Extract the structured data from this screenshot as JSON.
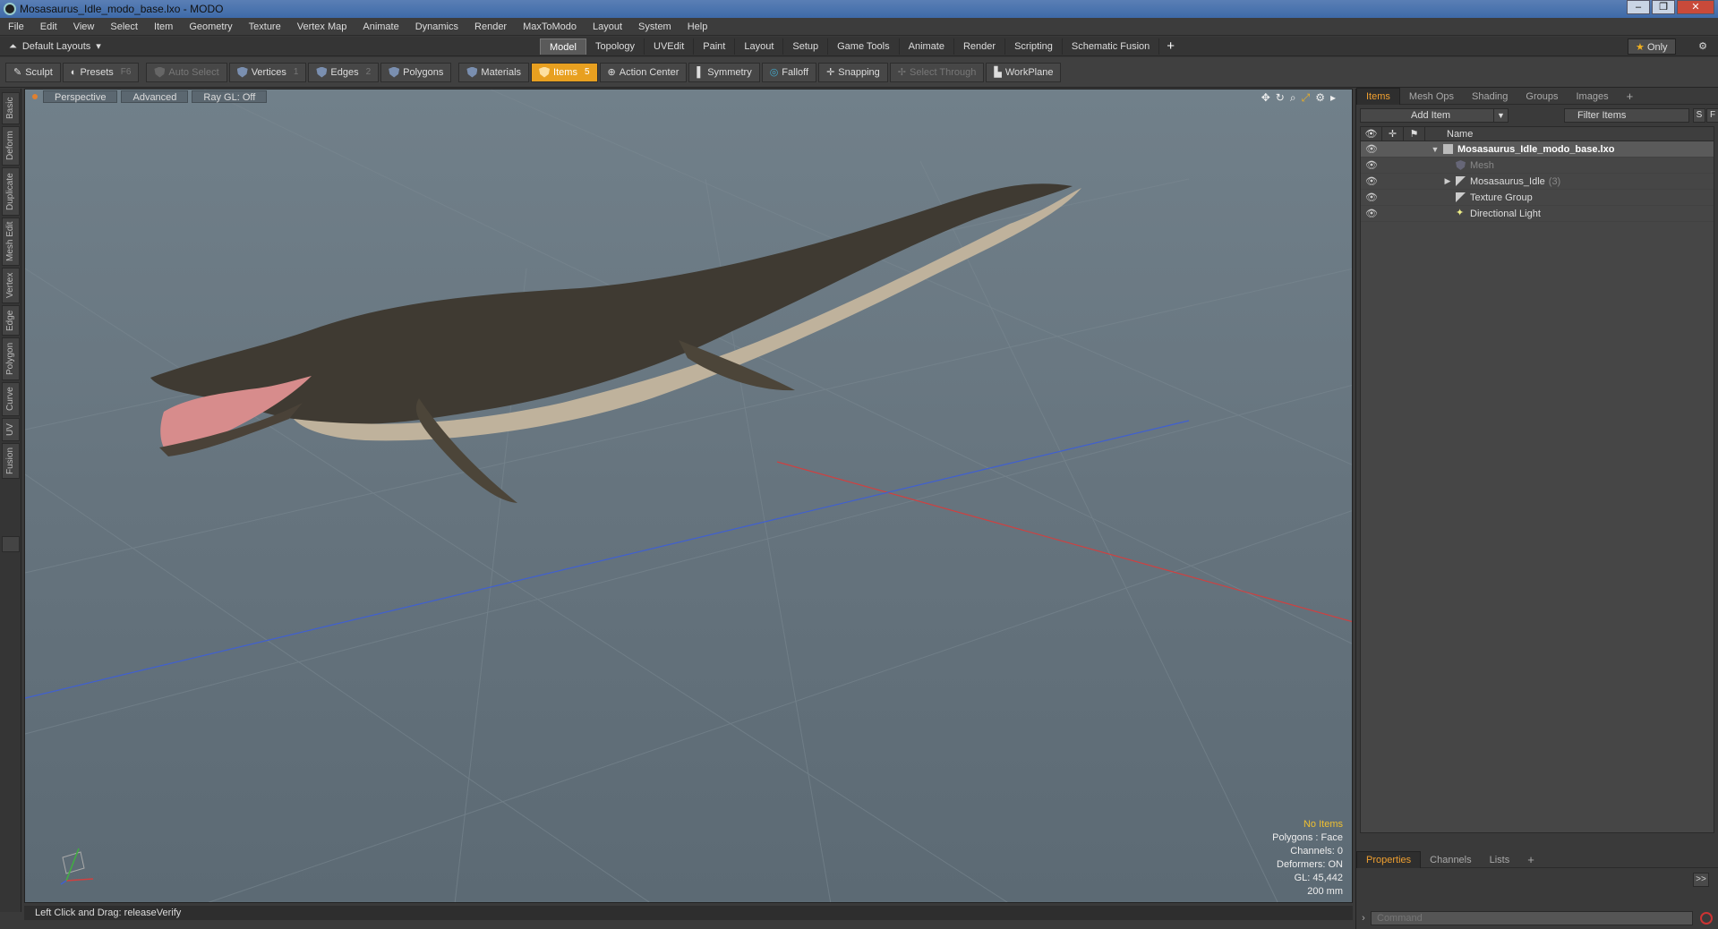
{
  "window": {
    "title": "Mosasaurus_Idle_modo_base.lxo - MODO",
    "buttons": [
      "–",
      "❐",
      "✕"
    ]
  },
  "menubar": [
    "File",
    "Edit",
    "View",
    "Select",
    "Item",
    "Geometry",
    "Texture",
    "Vertex Map",
    "Animate",
    "Dynamics",
    "Render",
    "MaxToModo",
    "Layout",
    "System",
    "Help"
  ],
  "layout_bar": {
    "layout_dropdown": "Default Layouts",
    "tabs": [
      "Model",
      "Topology",
      "UVEdit",
      "Paint",
      "Layout",
      "Setup",
      "Game Tools",
      "Animate",
      "Render",
      "Scripting",
      "Schematic Fusion"
    ],
    "active_tab": "Model",
    "add_label": "+",
    "only_label": "Only"
  },
  "toolbar": {
    "sculpt": "Sculpt",
    "presets": "Presets",
    "presets_key": "F6",
    "auto_select": "Auto Select",
    "vertices": "Vertices",
    "vertices_key": "1",
    "edges": "Edges",
    "edges_key": "2",
    "polygons": "Polygons",
    "materials": "Materials",
    "items": "Items",
    "items_key": "5",
    "action_center": "Action Center",
    "symmetry": "Symmetry",
    "falloff": "Falloff",
    "snapping": "Snapping",
    "select_through": "Select Through",
    "workplane": "WorkPlane"
  },
  "left_tabs": [
    "Basic",
    "Deform",
    "Duplicate",
    "Mesh Edit",
    "Vertex",
    "Edge",
    "Polygon",
    "Curve",
    "UV",
    "Fusion"
  ],
  "viewport": {
    "view_mode": "Perspective",
    "shading": "Advanced",
    "raygl": "Ray GL: Off",
    "info": {
      "selection": "No Items",
      "polygons": "Polygons : Face",
      "channels": "Channels: 0",
      "deformers": "Deformers: ON",
      "gl": "GL: 45,442",
      "scale": "200 mm"
    }
  },
  "statusbar": {
    "text": "Left Click and Drag:  releaseVerify"
  },
  "right_panel": {
    "tabs": [
      "Items",
      "Mesh Ops",
      "Shading",
      "Groups",
      "Images"
    ],
    "active_tab": "Items",
    "add_item": "Add Item",
    "filter_placeholder": "Filter Items",
    "s_btn": "S",
    "f_btn": "F",
    "column_name": "Name",
    "items": [
      {
        "label": "Mosasaurus_Idle_modo_base.lxo",
        "type": "scene"
      },
      {
        "label": "Mesh",
        "type": "mesh"
      },
      {
        "label": "Mosasaurus_Idle",
        "count": "(3)",
        "type": "group"
      },
      {
        "label": "Texture Group",
        "type": "group"
      },
      {
        "label": "Directional Light",
        "type": "light"
      }
    ],
    "bottom_tabs": [
      "Properties",
      "Channels",
      "Lists"
    ],
    "bottom_active": "Properties",
    "expand": ">>",
    "command_placeholder": "Command"
  },
  "colors": {
    "accent": "#e8a020",
    "viewport_bg": "#6b7983",
    "axis_x": "#d04040",
    "axis_z": "#4060d0"
  }
}
